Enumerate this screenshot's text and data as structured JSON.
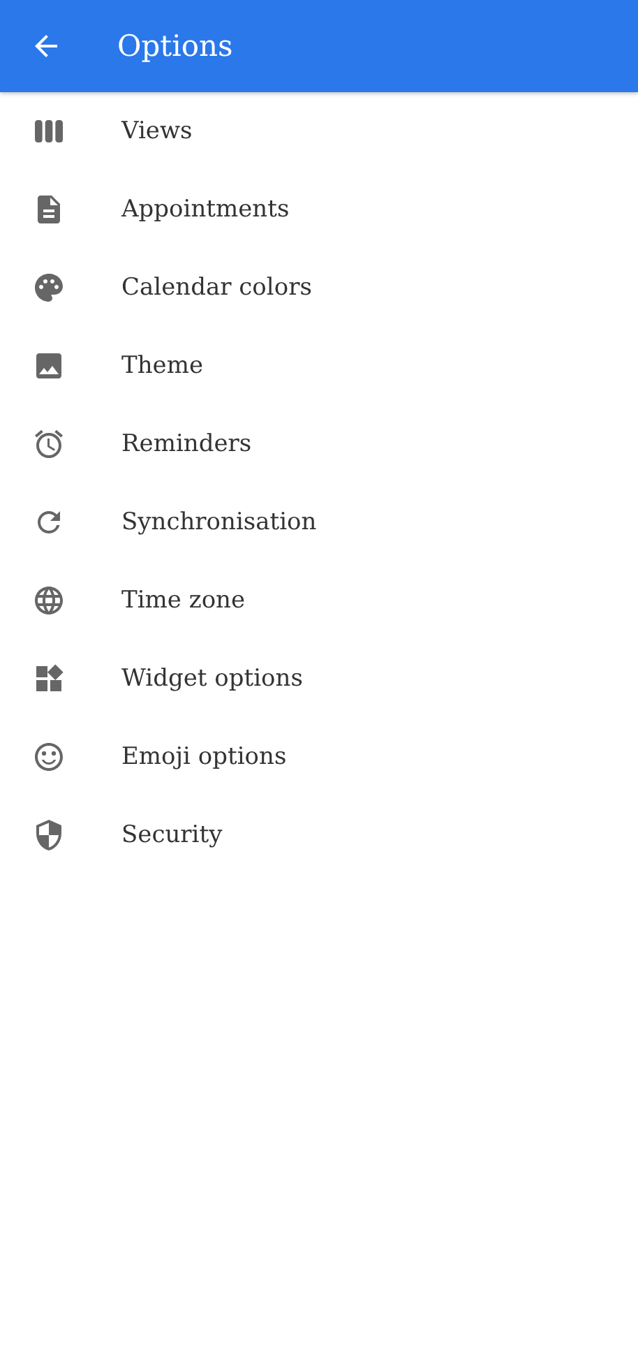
{
  "app_bar": {
    "title": "Options"
  },
  "menu_items": [
    {
      "label": "Views"
    },
    {
      "label": "Appointments"
    },
    {
      "label": "Calendar colors"
    },
    {
      "label": "Theme"
    },
    {
      "label": "Reminders"
    },
    {
      "label": "Synchronisation"
    },
    {
      "label": "Time zone"
    },
    {
      "label": "Widget options"
    },
    {
      "label": "Emoji options"
    },
    {
      "label": "Security"
    }
  ]
}
